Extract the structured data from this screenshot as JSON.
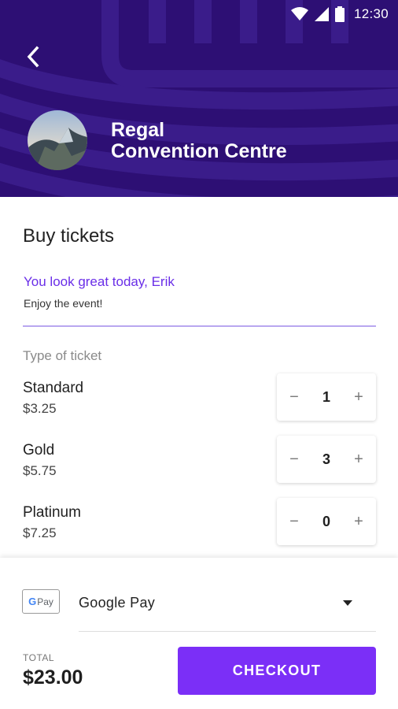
{
  "status_bar": {
    "time": "12:30"
  },
  "header": {
    "venue_line1": "Regal",
    "venue_line2": "Convention Centre",
    "background_color": "#2d0f74"
  },
  "icons": {
    "back": "arrow-left-icon",
    "wifi": "wifi-icon",
    "signal": "signal-icon",
    "battery": "battery-icon",
    "dropdown": "caret-down-icon"
  },
  "buy": {
    "title": "Buy tickets",
    "greeting": "You look great today, Erik",
    "greeting_sub": "Enjoy the event!",
    "ticket_type_label": "Type of ticket"
  },
  "tickets": [
    {
      "name": "Standard",
      "price": "$3.25",
      "quantity": "1"
    },
    {
      "name": "Gold",
      "price": "$5.75",
      "quantity": "3"
    },
    {
      "name": "Platinum",
      "price": "$7.25",
      "quantity": "0"
    }
  ],
  "stepper": {
    "minus": "−",
    "plus": "+"
  },
  "payment": {
    "logo_g": "G",
    "logo_pay": "Pay",
    "method": "Google Pay"
  },
  "total": {
    "label": "TOTAL",
    "amount": "$23.00"
  },
  "checkout_label": "CHECKOUT",
  "colors": {
    "accent": "#7b2ff7",
    "greeting": "#6a2ee8",
    "header": "#2d0f74"
  }
}
